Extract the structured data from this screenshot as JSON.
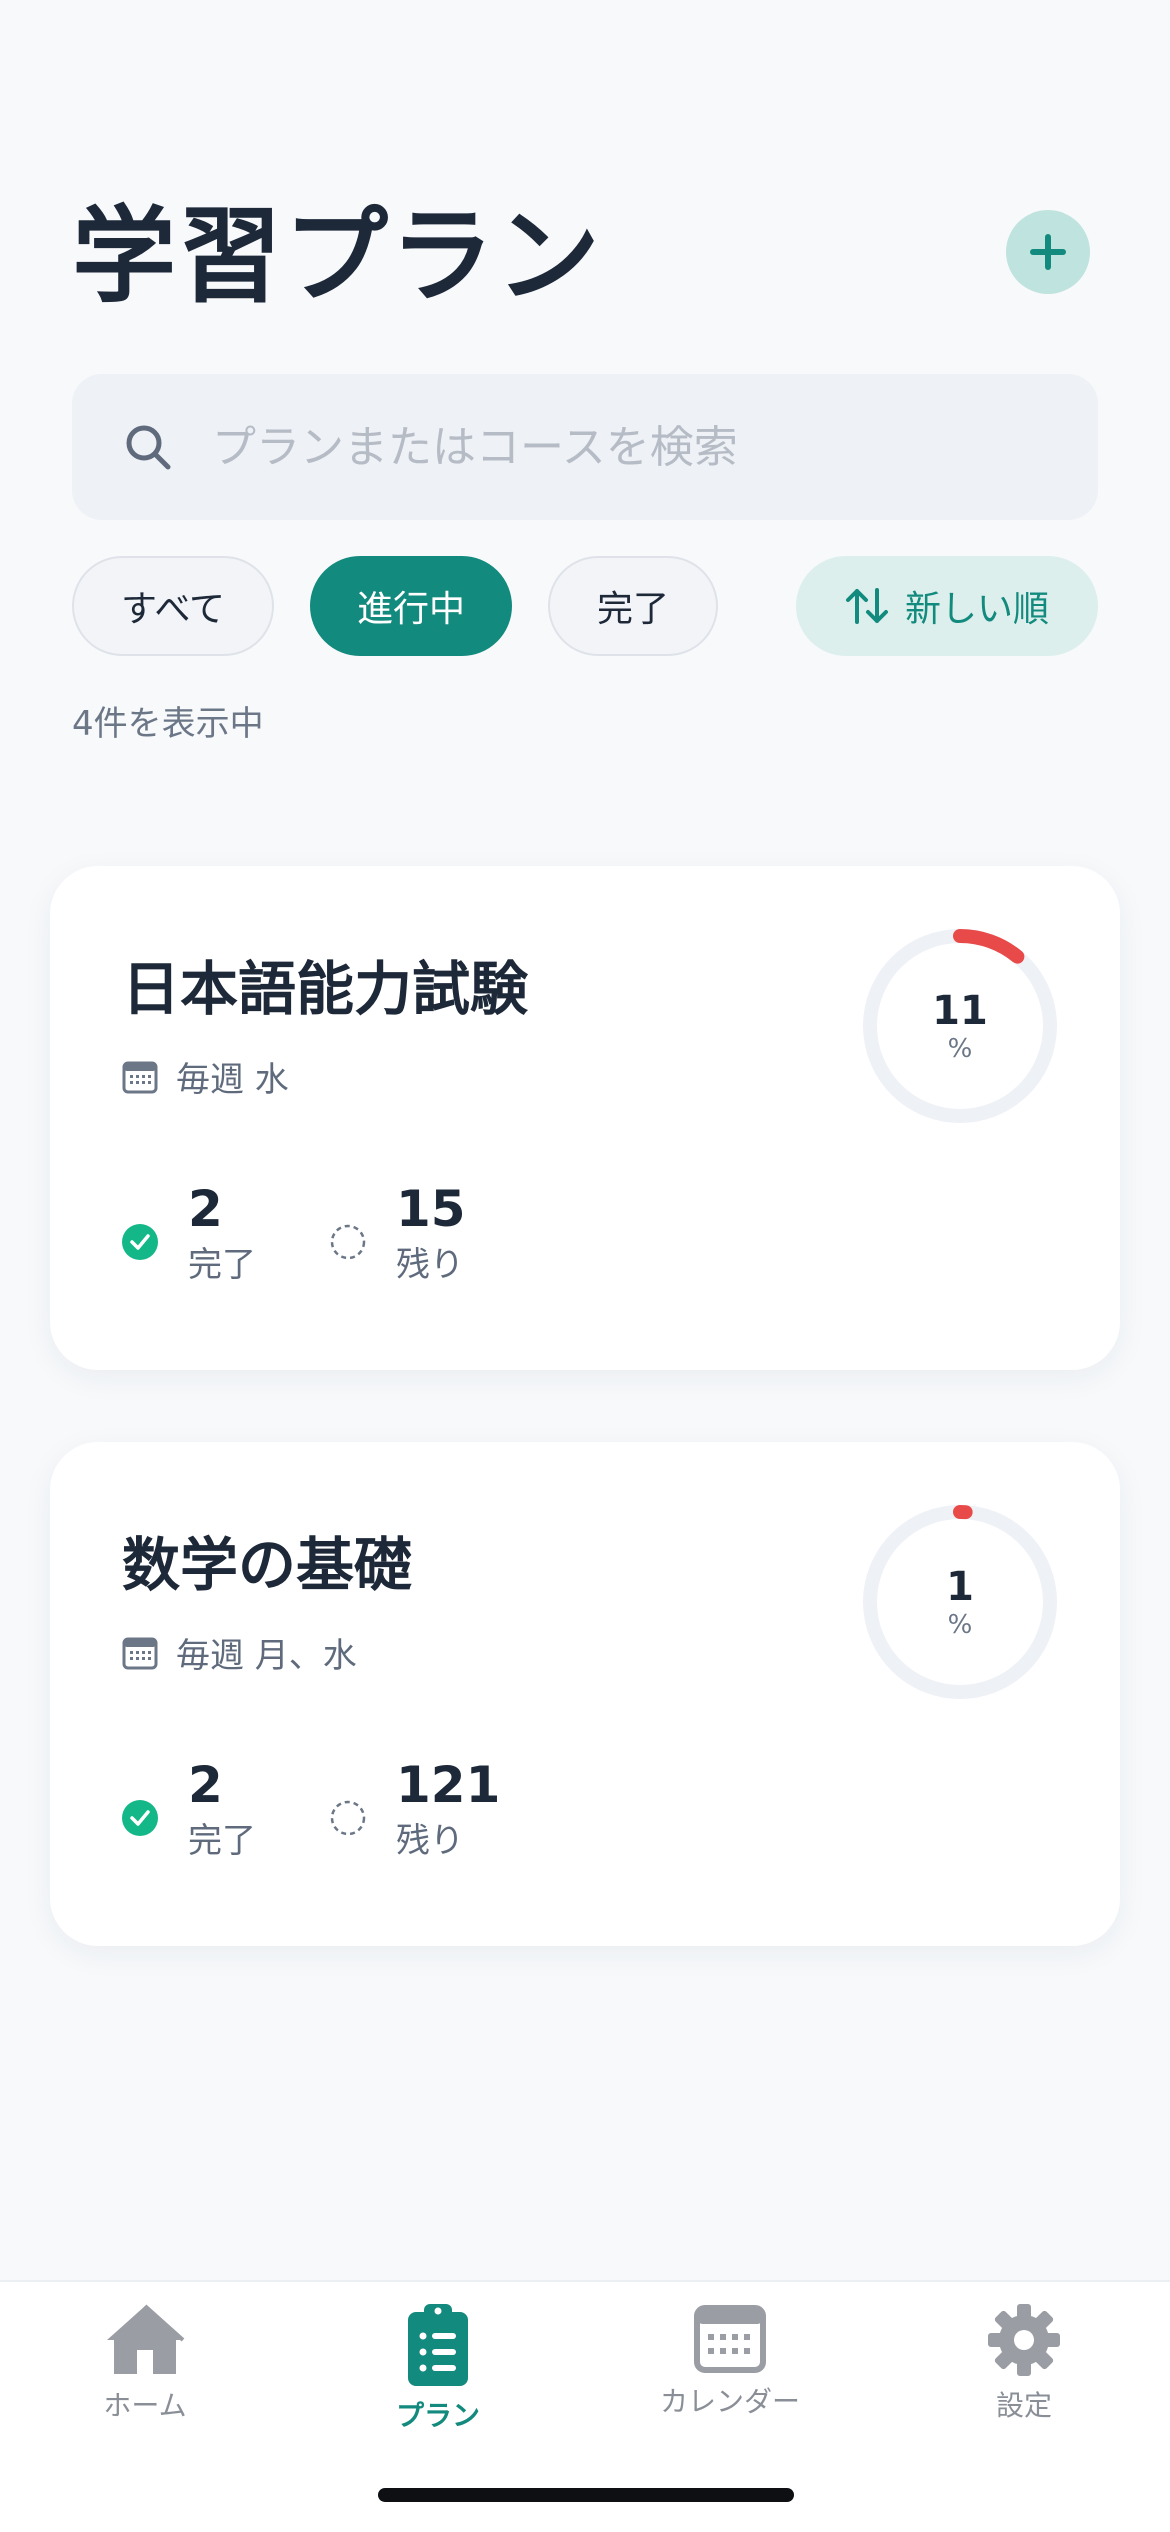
{
  "header": {
    "title": "学習プラン"
  },
  "search": {
    "placeholder": "プランまたはコースを検索"
  },
  "filters": [
    {
      "label": "すべて",
      "active": false
    },
    {
      "label": "進行中",
      "active": true
    },
    {
      "label": "完了",
      "active": false
    }
  ],
  "sort": {
    "label": "新しい順"
  },
  "result_count": "4件を表示中",
  "plans": [
    {
      "title": "日本語能力試験",
      "schedule": "毎週 水",
      "progress_percent": 11,
      "progress_value": "11",
      "progress_unit": "%",
      "completed_count": "2",
      "completed_label": "完了",
      "remaining_count": "15",
      "remaining_label": "残り"
    },
    {
      "title": "数学の基礎",
      "schedule": "毎週 月、水",
      "progress_percent": 1,
      "progress_value": "1",
      "progress_unit": "%",
      "completed_count": "2",
      "completed_label": "完了",
      "remaining_count": "121",
      "remaining_label": "残り"
    }
  ],
  "nav": [
    {
      "label": "ホーム",
      "icon": "home-icon",
      "active": false
    },
    {
      "label": "プラン",
      "icon": "clipboard-list-icon",
      "active": true
    },
    {
      "label": "カレンダー",
      "icon": "calendar-icon",
      "active": false
    },
    {
      "label": "設定",
      "icon": "gear-icon",
      "active": false
    }
  ],
  "colors": {
    "accent": "#138a7e",
    "accent_light": "#bfe3de",
    "progress": "#e84a4a",
    "check": "#14b888",
    "text": "#1d2838"
  }
}
